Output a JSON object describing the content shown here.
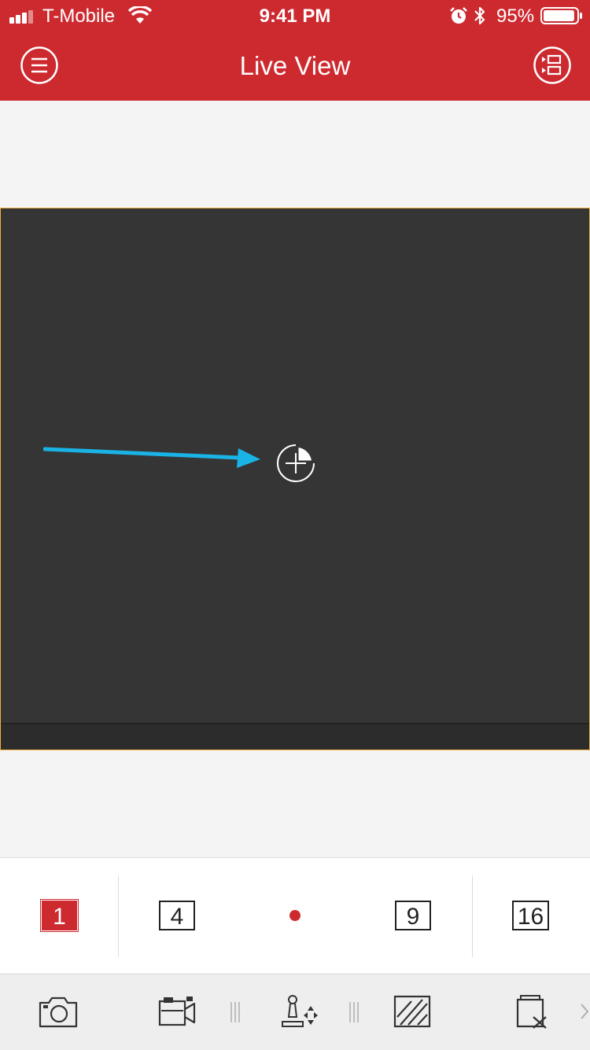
{
  "status_bar": {
    "carrier": "T-Mobile",
    "time": "9:41 PM",
    "battery_percent": "95%",
    "signal_bars": 3,
    "battery_level": 0.95
  },
  "nav": {
    "title": "Live View",
    "menu_icon": "hamburger-menu-icon",
    "device_icon": "device-list-icon"
  },
  "live_view": {
    "add_icon": "add-camera-icon",
    "annotation": "arrow-pointing-to-add-camera"
  },
  "layout_options": {
    "items": [
      "1",
      "4",
      "9",
      "16"
    ],
    "selected": "1"
  },
  "toolbar": {
    "items": [
      "camera-snapshot-icon",
      "video-record-icon",
      "ptz-control-icon",
      "image-quality-icon",
      "close-all-icon"
    ]
  },
  "colors": {
    "brand_red": "#cd2a30",
    "live_bg": "#353535",
    "selected_border": "#f0b23c",
    "annotation_arrow": "#1ab3e6"
  }
}
